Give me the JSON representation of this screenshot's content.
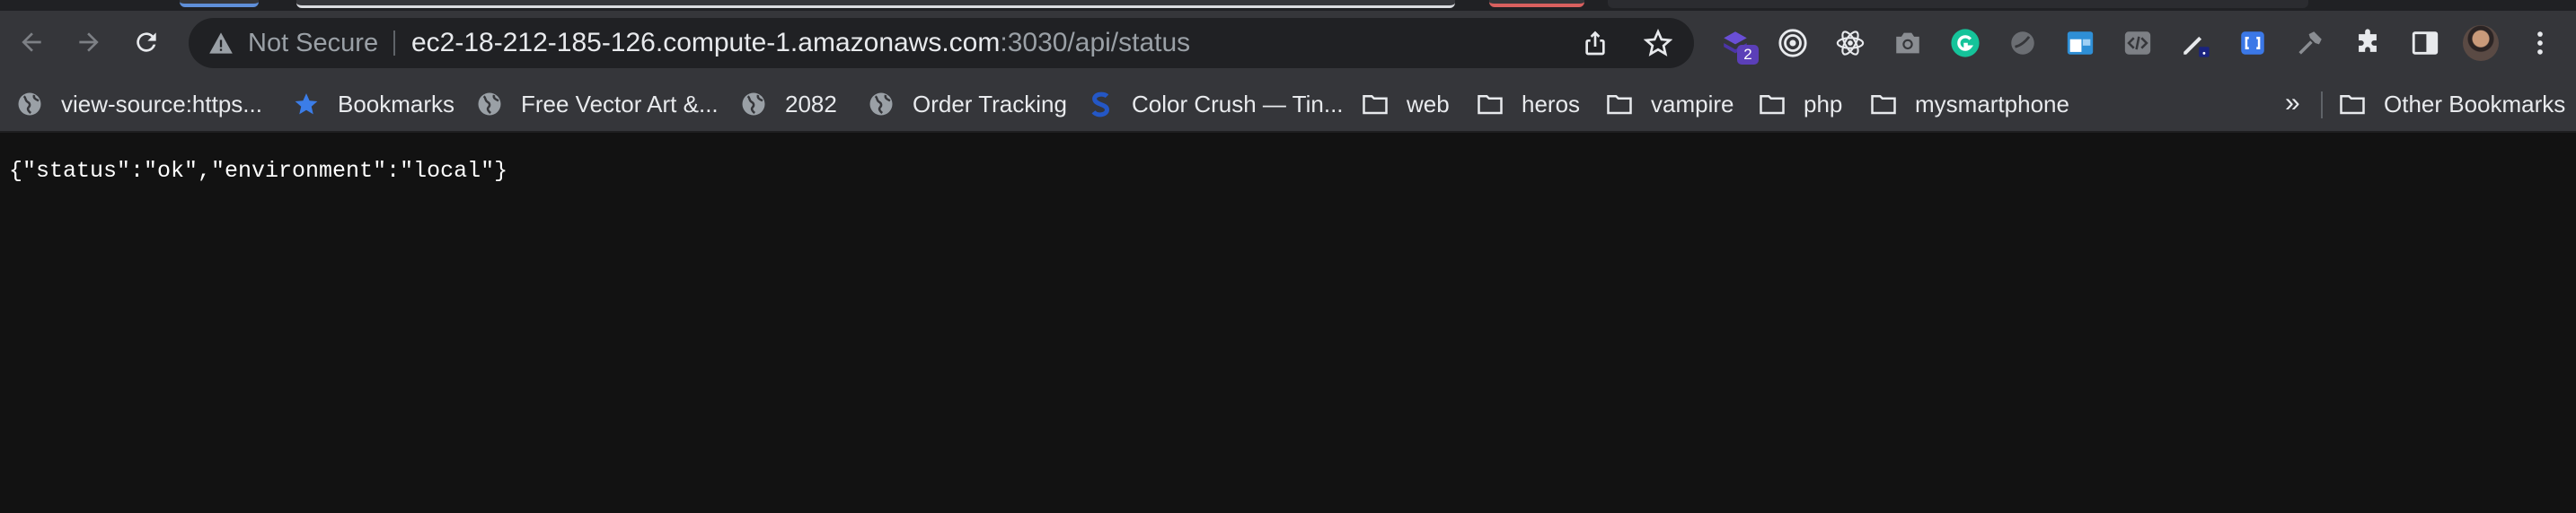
{
  "toolbar": {
    "security_label": "Not Secure",
    "url_host": "ec2-18-212-185-126.compute-1.amazonaws.com",
    "url_path": ":3030/api/status",
    "extension_badge": "2"
  },
  "bookmarks": [
    {
      "label": "view-source:https...",
      "icon": "globe-icon"
    },
    {
      "label": "Bookmarks",
      "icon": "star-icon"
    },
    {
      "label": "Free Vector Art &...",
      "icon": "globe-icon"
    },
    {
      "label": "2082",
      "icon": "globe-icon"
    },
    {
      "label": "Order Tracking",
      "icon": "globe-icon"
    },
    {
      "label": "Color Crush — Tin...",
      "icon": "s-logo-icon"
    },
    {
      "label": "web",
      "icon": "folder-icon"
    },
    {
      "label": "heros",
      "icon": "folder-icon"
    },
    {
      "label": "vampire",
      "icon": "folder-icon"
    },
    {
      "label": "php",
      "icon": "folder-icon"
    },
    {
      "label": "mysmartphone",
      "icon": "folder-icon"
    }
  ],
  "bookmarks_overflow": "»",
  "other_bookmarks": "Other Bookmarks",
  "page": {
    "body_text": "{\"status\":\"ok\",\"environment\":\"local\"}"
  },
  "colors": {
    "toolbar": "#35363a",
    "omnibox": "#202124",
    "page_background": "#121212"
  }
}
